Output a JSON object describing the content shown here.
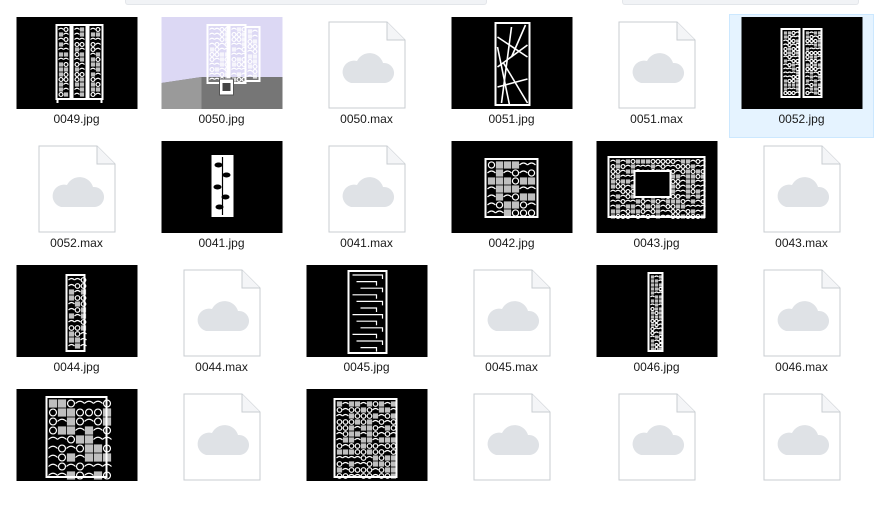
{
  "files": [
    {
      "name": "0049.jpg",
      "kind": "image",
      "preview": "triple-panel-screen",
      "selected": false
    },
    {
      "name": "0050.jpg",
      "kind": "image",
      "preview": "room-render",
      "selected": false
    },
    {
      "name": "0050.max",
      "kind": "max",
      "preview": "cloud-file-icon",
      "selected": false
    },
    {
      "name": "0051.jpg",
      "kind": "image",
      "preview": "branch-panel",
      "selected": false
    },
    {
      "name": "0051.max",
      "kind": "max",
      "preview": "cloud-file-icon",
      "selected": false
    },
    {
      "name": "0052.jpg",
      "kind": "image",
      "preview": "double-panel-screen",
      "selected": true
    },
    {
      "name": "0052.max",
      "kind": "max",
      "preview": "cloud-file-icon",
      "selected": false
    },
    {
      "name": "0041.jpg",
      "kind": "image",
      "preview": "leaf-panel",
      "selected": false
    },
    {
      "name": "0041.max",
      "kind": "max",
      "preview": "cloud-file-icon",
      "selected": false
    },
    {
      "name": "0042.jpg",
      "kind": "image",
      "preview": "square-lattice",
      "selected": false
    },
    {
      "name": "0043.jpg",
      "kind": "image",
      "preview": "wide-lattice-frame",
      "selected": false
    },
    {
      "name": "0043.max",
      "kind": "max",
      "preview": "cloud-file-icon",
      "selected": false
    },
    {
      "name": "0044.jpg",
      "kind": "image",
      "preview": "narrow-panel",
      "selected": false
    },
    {
      "name": "0044.max",
      "kind": "max",
      "preview": "cloud-file-icon",
      "selected": false
    },
    {
      "name": "0045.jpg",
      "kind": "image",
      "preview": "maze-panel",
      "selected": false
    },
    {
      "name": "0045.max",
      "kind": "max",
      "preview": "cloud-file-icon",
      "selected": false
    },
    {
      "name": "0046.jpg",
      "kind": "image",
      "preview": "slim-panel",
      "selected": false
    },
    {
      "name": "0046.max",
      "kind": "max",
      "preview": "cloud-file-icon",
      "selected": false
    },
    {
      "name": "",
      "kind": "image",
      "preview": "floral-panel",
      "selected": false
    },
    {
      "name": "",
      "kind": "max",
      "preview": "cloud-file-icon",
      "selected": false
    },
    {
      "name": "",
      "kind": "image",
      "preview": "dense-lattice",
      "selected": false
    },
    {
      "name": "",
      "kind": "max",
      "preview": "cloud-file-icon",
      "selected": false
    },
    {
      "name": "",
      "kind": "max",
      "preview": "cloud-file-icon",
      "selected": false
    },
    {
      "name": "",
      "kind": "max",
      "preview": "cloud-file-icon",
      "selected": false
    }
  ],
  "colors": {
    "selection_bg": "#e5f3ff",
    "selection_border": "#cce8ff",
    "cloud": "#dfe2e6",
    "doc_border": "#c9cdd2"
  }
}
